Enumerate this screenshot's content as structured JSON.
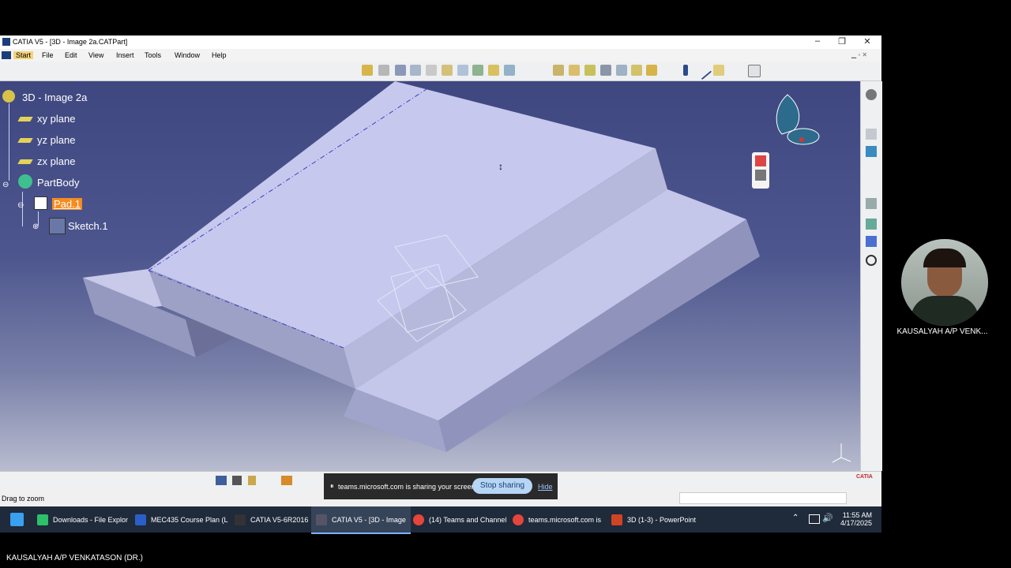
{
  "window": {
    "title": "CATIA V5 - [3D - Image 2a.CATPart]"
  },
  "menu": [
    "Start",
    "File",
    "Edit",
    "View",
    "Insert",
    "Tools",
    "Window",
    "Help"
  ],
  "tree": {
    "root": "3D - Image 2a",
    "planes": [
      "xy plane",
      "yz plane",
      "zx plane"
    ],
    "body": "PartBody",
    "pad": "Pad.1",
    "sketch": "Sketch.1"
  },
  "status": {
    "text": "Drag to zoom"
  },
  "sharing": {
    "message": "teams.microsoft.com is sharing your screen.",
    "stop_label": "Stop sharing",
    "hide_label": "Hide"
  },
  "taskbar": {
    "items": [
      "Downloads - File Explor",
      "MEC435 Course Plan (L",
      "CATIA V5-6R2016",
      "CATIA V5 - [3D - Image",
      "(14) Teams and Channel",
      "teams.microsoft.com is",
      "3D (1-3) - PowerPoint"
    ],
    "time": "11:55 AM",
    "date": "4/17/2025"
  },
  "participant": {
    "name": "KAUSALYAH A/P VENK...",
    "full_name": "KAUSALYAH A/P VENKATASON (DR.)"
  },
  "brand": {
    "logo_text": "CATIA"
  },
  "colors": {
    "viewport_top": "#3f4780",
    "accent": "#f5a623",
    "taskbar": "#1f2a3b"
  }
}
